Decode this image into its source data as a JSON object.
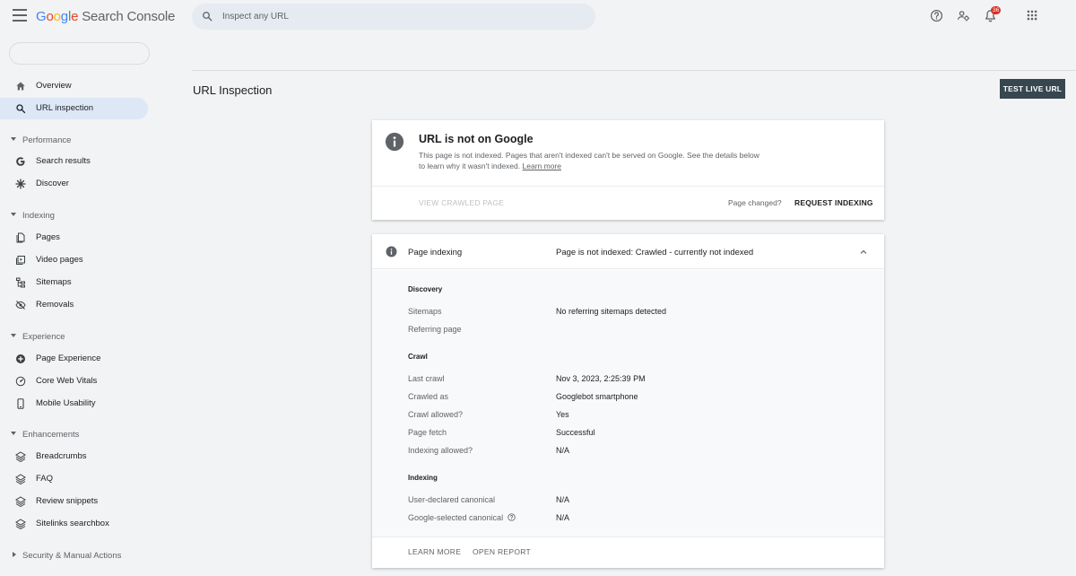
{
  "header": {
    "logo_google": [
      "G",
      "o",
      "o",
      "g",
      "l",
      "e"
    ],
    "logo_product": "Search Console",
    "search_placeholder": "Inspect any URL",
    "notification_count": "36",
    "icons": [
      "help-icon",
      "manage-users-icon",
      "notifications-icon",
      "apps-grid-icon"
    ]
  },
  "sidebar": {
    "top_items": [
      {
        "label": "Overview",
        "icon": "home-icon"
      },
      {
        "label": "URL inspection",
        "icon": "search-icon",
        "active": true
      }
    ],
    "sections": [
      {
        "label": "Performance",
        "items": [
          {
            "label": "Search results",
            "icon": "google-g-icon"
          },
          {
            "label": "Discover",
            "icon": "asterisk-icon"
          }
        ]
      },
      {
        "label": "Indexing",
        "items": [
          {
            "label": "Pages",
            "icon": "pages-icon"
          },
          {
            "label": "Video pages",
            "icon": "video-pages-icon"
          },
          {
            "label": "Sitemaps",
            "icon": "sitemaps-icon"
          },
          {
            "label": "Removals",
            "icon": "removals-icon"
          }
        ]
      },
      {
        "label": "Experience",
        "items": [
          {
            "label": "Page Experience",
            "icon": "plus-circle-icon"
          },
          {
            "label": "Core Web Vitals",
            "icon": "gauge-icon"
          },
          {
            "label": "Mobile Usability",
            "icon": "phone-icon"
          }
        ]
      },
      {
        "label": "Enhancements",
        "items": [
          {
            "label": "Breadcrumbs",
            "icon": "layers-icon"
          },
          {
            "label": "FAQ",
            "icon": "layers-icon"
          },
          {
            "label": "Review snippets",
            "icon": "layers-icon"
          },
          {
            "label": "Sitelinks searchbox",
            "icon": "layers-icon"
          }
        ]
      }
    ],
    "collapsed_section": "Security & Manual Actions"
  },
  "main": {
    "page_title": "URL Inspection",
    "test_live_label": "TEST LIVE URL",
    "status_card": {
      "title": "URL is not on Google",
      "description": "This page is not indexed. Pages that aren't indexed can't be served on Google. See the details below to learn why it wasn't indexed.",
      "learn_more": "Learn more",
      "view_crawled": "VIEW CRAWLED PAGE",
      "page_changed": "Page changed?",
      "request_indexing": "REQUEST INDEXING"
    },
    "indexing_card": {
      "name": "Page indexing",
      "status": "Page is not indexed: Crawled - currently not indexed",
      "discovery_title": "Discovery",
      "sitemaps_k": "Sitemaps",
      "sitemaps_v": "No referring sitemaps detected",
      "referring_k": "Referring page",
      "crawl_title": "Crawl",
      "last_crawl_k": "Last crawl",
      "last_crawl_v": "Nov 3, 2023, 2:25:39 PM",
      "crawled_as_k": "Crawled as",
      "crawled_as_v": "Googlebot smartphone",
      "crawl_allowed_k": "Crawl allowed?",
      "crawl_allowed_v": "Yes",
      "page_fetch_k": "Page fetch",
      "page_fetch_v": "Successful",
      "indexing_allowed_k": "Indexing allowed?",
      "indexing_allowed_v": "N/A",
      "indexing_title": "Indexing",
      "user_canonical_k": "User-declared canonical",
      "user_canonical_v": "N/A",
      "google_canonical_k": "Google-selected canonical",
      "google_canonical_v": "N/A",
      "learn_more": "LEARN MORE",
      "open_report": "OPEN REPORT"
    }
  },
  "colors": {
    "background": "#f1f3f4",
    "active_nav": "#dde7f6",
    "primary_button": "#37474f",
    "badge": "#d93025"
  }
}
